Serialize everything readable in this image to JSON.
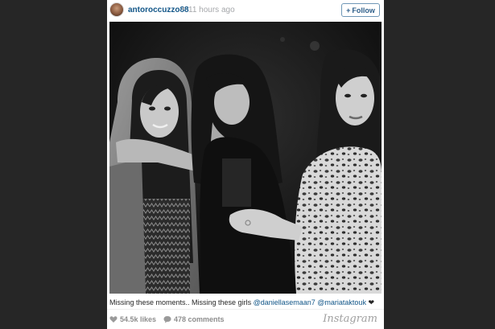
{
  "post": {
    "username": "antoroccuzzo88",
    "separator": "•",
    "time": "11 hours ago",
    "follow_label": "Follow",
    "follow_glyph": "+"
  },
  "caption": {
    "text": "Missing these moments.. Missing these girls",
    "mention_1": "@daniellasemaan7",
    "mention_2": "@mariataktouk",
    "heart": "❤"
  },
  "stats": {
    "likes": "54.5k likes",
    "comments": "478 comments"
  },
  "branding": {
    "logo": "Instagram"
  },
  "icons": {
    "likes": "heart-icon",
    "comments": "comment-bubble-icon"
  },
  "colors": {
    "page_bg": "#262626",
    "card_bg": "#ffffff",
    "link": "#125688",
    "muted": "#a5a7aa"
  }
}
